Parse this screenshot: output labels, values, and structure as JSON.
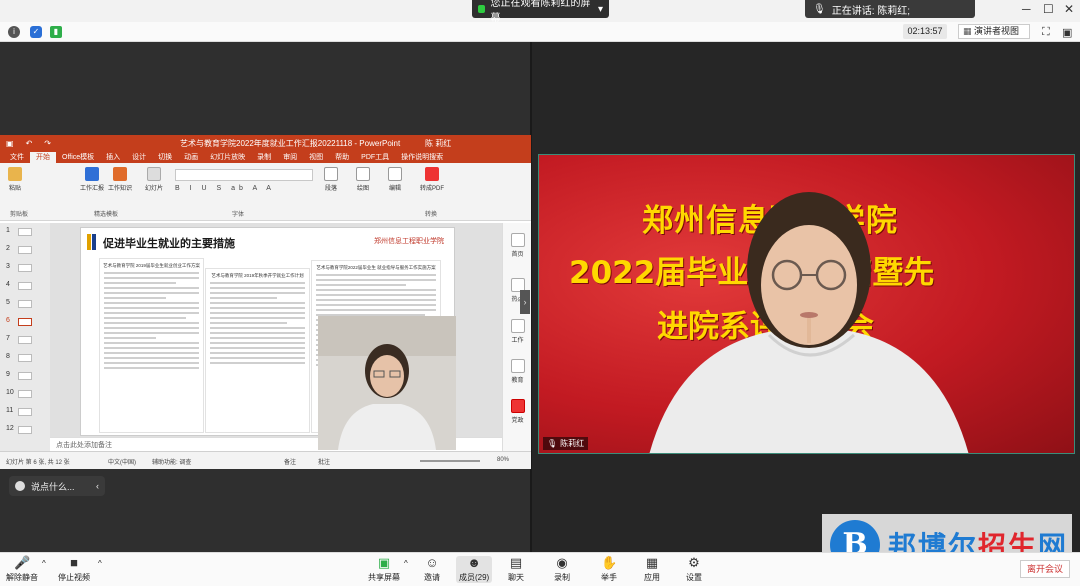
{
  "topbar": {
    "share_banner": "您正在观看陈莉红的屏幕",
    "speaker_label": "正在讲话: 陈莉红;",
    "timer": "02:13:57",
    "view_mode": "演讲者视图"
  },
  "ppt": {
    "window_title": "艺术与教育学院2022年度就业工作汇报20221118  -  PowerPoint",
    "user_name": "陈 莉红",
    "menu": [
      "文件",
      "开始",
      "Office模板",
      "插入",
      "设计",
      "切换",
      "动画",
      "幻灯片放映",
      "录制",
      "审阅",
      "视图",
      "帮助",
      "PDF工具",
      "操作说明搜索"
    ],
    "ribbon": {
      "paste": "粘贴",
      "clipboard": "剪贴板",
      "report": "工作汇报",
      "know": "工作知识",
      "templates": "精选模板",
      "new_slide": "幻灯片",
      "font_group": "字体",
      "paragraph": "段落",
      "draw": "绘图",
      "edit": "编辑",
      "to_pdf": "转成PDF",
      "convert": "转换"
    },
    "slide_title": "促进毕业生就业的主要措施",
    "slide_logo": "郑州信息工程职业学院",
    "doc1_title": "艺术与教育学院 2019届毕业生就业创业工作方案",
    "doc2_title": "艺术与教育学院 2019年秋季开学就业工作计划",
    "doc3_title": "艺术与教育学院2022届毕业生 就业指导与服务工作实施方案",
    "notes": "点击此处添加备注",
    "status": {
      "slide_info": "幻灯片 第 6 张, 共 12 张",
      "language": "中文(中国)",
      "accessibility": "辅助功能: 调查",
      "notes_btn": "备注",
      "comments_btn": "批注",
      "zoom": "80%"
    },
    "thumbs": [
      "1",
      "2",
      "3",
      "4",
      "5",
      "6",
      "7",
      "8",
      "9",
      "10",
      "11",
      "12"
    ],
    "selected_thumb": 6,
    "side_panel": [
      "首页",
      "热点",
      "工作",
      "教育",
      "党政"
    ]
  },
  "chat_pill": "说点什么...",
  "video": {
    "line1": "郑州信息职业学院",
    "line2": "2022届毕业工作总结暨先",
    "line3": "进院系评优大会",
    "name": "陈莉红"
  },
  "bottombar": {
    "unmute": "解除静音",
    "stop_video": "停止视频",
    "share": "共享屏幕",
    "invite": "邀请",
    "members": "成员(29)",
    "chat": "聊天",
    "record": "录制",
    "raise_hand": "举手",
    "apps": "应用",
    "settings": "设置",
    "leave": "离开会议"
  },
  "watermark": {
    "text_blue": "邦博尔",
    "text_red": "招生",
    "text_blue2": "网"
  },
  "colors": {
    "ppt_red": "#c43e1c",
    "slide_gold": "#ffd800",
    "bg_red": "#c8202a"
  }
}
